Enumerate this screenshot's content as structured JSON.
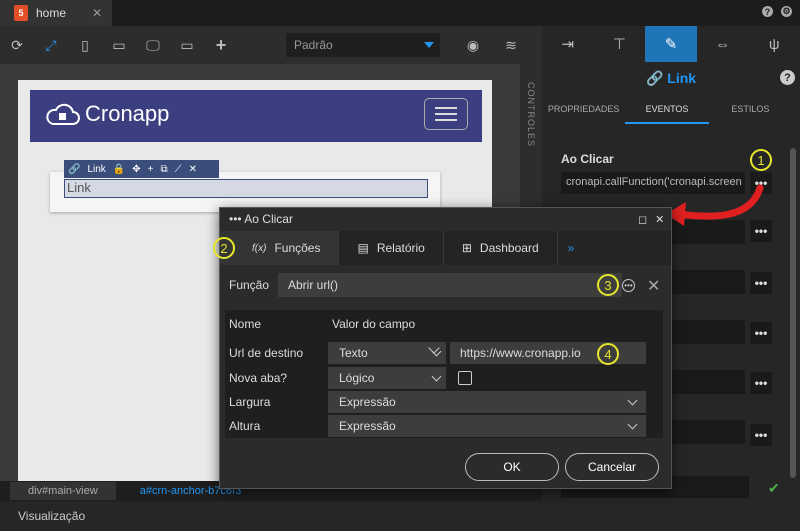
{
  "tab": {
    "icon": "5",
    "name": "home",
    "close": "✕"
  },
  "toolbar": {
    "preset": "Padrão"
  },
  "canvas": {
    "logo": "Cronapp",
    "link_toolbar_label": "Link",
    "link_text": "Link"
  },
  "controls_label": "CONTROLES",
  "right_panel": {
    "title": "Link",
    "subtabs": [
      "PROPRIEDADES",
      "EVENTOS",
      "ESTILOS"
    ],
    "on_click_label": "Ao Clicar",
    "on_click_value": "cronapi.callFunction('cronapi.screen",
    "dots": "•••"
  },
  "statusbar": {
    "path1": "div#main-view",
    "path2": "a#crn-anchor-b7c6f3"
  },
  "view_label": "Visualização",
  "dialog": {
    "title": "Ao Clicar",
    "tabs": [
      "Funções",
      "Relatório",
      "Dashboard",
      "»"
    ],
    "func_label": "Função",
    "func_value": "Abrir url()",
    "col_name": "Nome",
    "col_value": "Valor do campo",
    "rows": [
      {
        "name": "Url de destino",
        "type": "Texto",
        "value": "https://www.cronapp.io"
      },
      {
        "name": "Nova aba?",
        "type": "Lógico"
      },
      {
        "name": "Largura",
        "type": "Expressão"
      },
      {
        "name": "Altura",
        "type": "Expressão"
      }
    ],
    "ok": "OK",
    "cancel": "Cancelar"
  },
  "annotations": [
    "1",
    "2",
    "3",
    "4"
  ]
}
